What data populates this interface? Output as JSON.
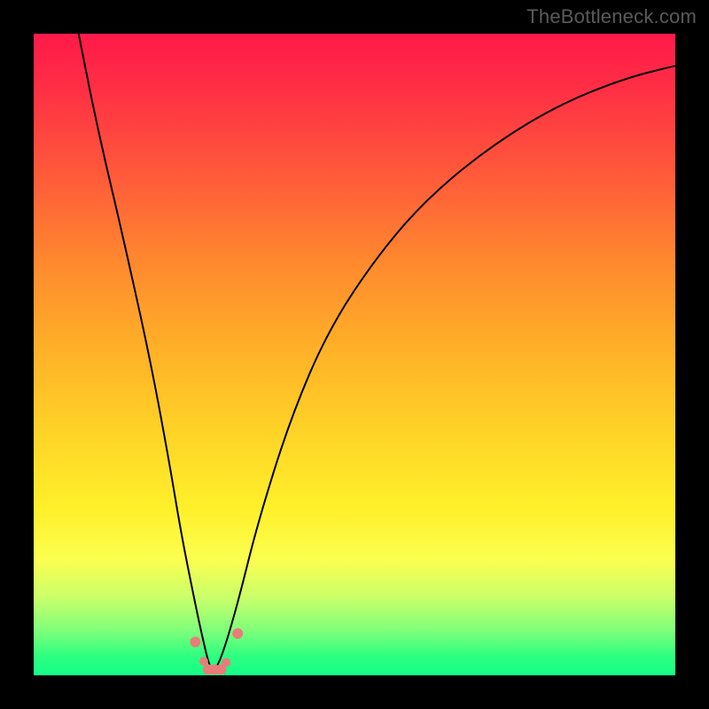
{
  "watermark": "TheBottleneck.com",
  "chart_data": {
    "type": "line",
    "title": "",
    "xlabel": "",
    "ylabel": "",
    "x_range": [
      0,
      100
    ],
    "y_range": [
      0,
      100
    ],
    "series": [
      {
        "name": "bottleneck-curve",
        "x": [
          7,
          10,
          14,
          18,
          21,
          23,
          25,
          26.5,
          27.5,
          28.5,
          30,
          32,
          35,
          40,
          46,
          54,
          62,
          72,
          82,
          92,
          100
        ],
        "y": [
          100,
          85,
          68,
          50,
          34,
          22,
          12,
          5,
          1,
          1,
          5,
          12,
          24,
          40,
          54,
          66,
          75,
          83,
          89,
          93,
          95
        ]
      }
    ],
    "markers": {
      "name": "bottleneck-markers",
      "x": [
        25.2,
        26.5,
        27.2,
        28.2,
        29.2,
        30.0,
        31.8
      ],
      "y": [
        5.2,
        2.2,
        0.9,
        0.9,
        0.9,
        2.0,
        6.5
      ],
      "r": [
        6,
        5,
        6,
        6,
        6,
        5,
        6
      ]
    },
    "gradient_stops": [
      {
        "pct": 0,
        "color": "#ff1a49"
      },
      {
        "pct": 50,
        "color": "#ffb327"
      },
      {
        "pct": 80,
        "color": "#fbff50"
      },
      {
        "pct": 100,
        "color": "#13ff8a"
      }
    ]
  }
}
